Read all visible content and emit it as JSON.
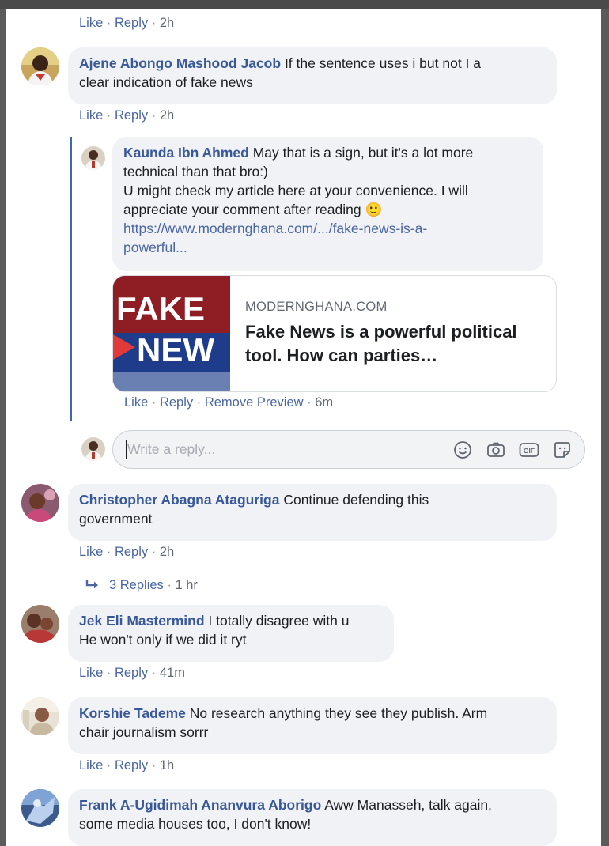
{
  "colors": {
    "author": "#385898",
    "link": "#4b67a1",
    "thread_line": "#4267b2",
    "bubble": "#f0f2f5",
    "muted": "#606770"
  },
  "separator": "·",
  "top_actions": {
    "like": "Like",
    "reply": "Reply",
    "time": "2h"
  },
  "comments": [
    {
      "author": "Ajene Abongo Mashood Jacob",
      "text": "If the sentence uses i but not I a",
      "text2": "clear indication of fake news",
      "like": "Like",
      "reply": "Reply",
      "time": "2h",
      "avatar_icon": "profile-photo"
    },
    {
      "author": "Christopher Abagna Ataguriga",
      "text": "Continue defending this",
      "text2": "government",
      "like": "Like",
      "reply": "Reply",
      "time": "2h",
      "avatar_icon": "profile-photo"
    },
    {
      "author": "Jek Eli Mastermind",
      "text": "I totally disagree with u",
      "text2": "He won't only if we did it ryt",
      "like": "Like",
      "reply": "Reply",
      "time": "41m",
      "avatar_icon": "profile-photo"
    },
    {
      "author": "Korshie Tademe",
      "text": "No research anything they see they publish. Arm",
      "text2": "chair journalism sorrr",
      "like": "Like",
      "reply": "Reply",
      "time": "1h",
      "avatar_icon": "profile-photo"
    },
    {
      "author": "Frank A-Ugidimah Ananvura Aborigo",
      "text": "Aww Manasseh, talk again,",
      "text2": "some media houses too, I don't know!",
      "avatar_icon": "profile-photo"
    }
  ],
  "nested_reply": {
    "author": "Kaunda Ibn Ahmed",
    "line1": "May that is a sign, but it's a lot more",
    "line2": "technical than that bro:)",
    "line3": "U might check my article here at your convenience. I will",
    "line4": "appreciate your comment after reading",
    "emoji": "🙂",
    "link1": "https://www.modernghana.com/.../fake-news-is-a-",
    "link2": "powerful...",
    "preview": {
      "domain": "MODERNGHANA.COM",
      "title": "Fake News is a powerful political tool. How can parties…",
      "image_text1": "FAKE",
      "image_text2": "NEW"
    },
    "like": "Like",
    "reply": "Reply",
    "remove_preview": "Remove Preview",
    "time": "6m"
  },
  "reply_box": {
    "placeholder": "Write a reply...",
    "tools": [
      "emoji-icon",
      "camera-icon",
      "gif-icon",
      "sticker-icon"
    ],
    "gif_label": "GIF"
  },
  "replies_link": {
    "text": "3 Replies",
    "time": "1 hr"
  }
}
